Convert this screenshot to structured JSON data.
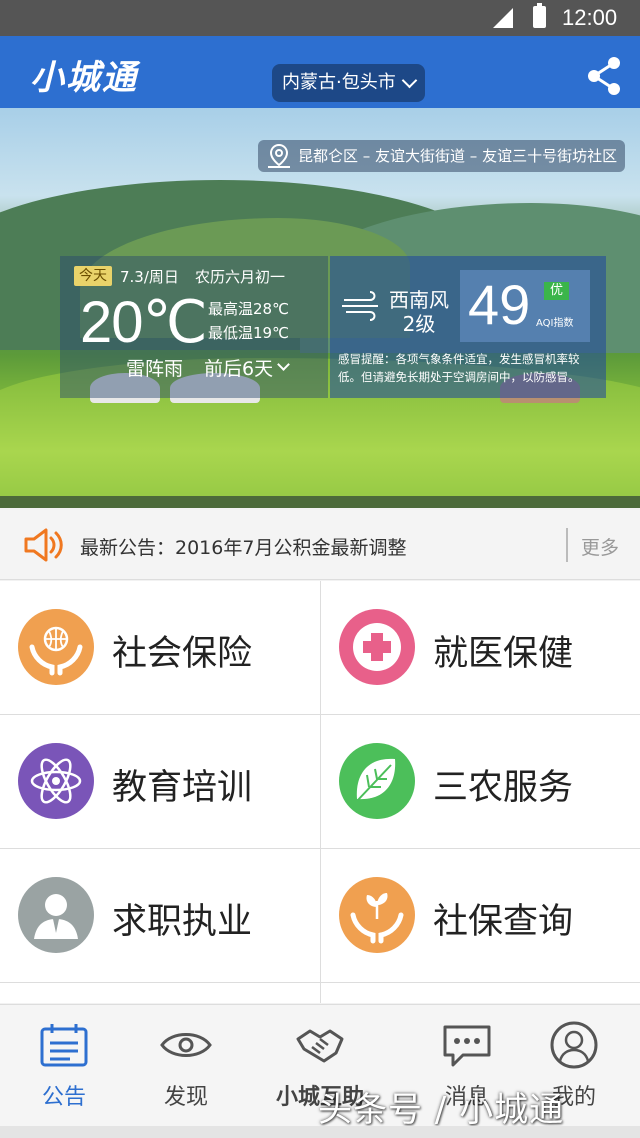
{
  "status_bar": {
    "time": "12:00"
  },
  "app_bar": {
    "title": "小城通",
    "city": "内蒙古·包头市"
  },
  "hero": {
    "address": "昆都仑区 – 友谊大街街道 – 友谊三十号街坊社区",
    "weather": {
      "today_tag": "今天",
      "date": "7.3/周日",
      "lunar": "农历六月初一",
      "temperature": "20℃",
      "high": "最高温28℃",
      "low": "最低温19℃",
      "condition": "雷阵雨",
      "forecast_link": "前后6天",
      "wind_direction": "西南风",
      "wind_level": "2级",
      "aqi_value": "49",
      "aqi_level": "优",
      "aqi_label": "AQI指数",
      "tip": "感冒提醒：各项气象条件适宜，发生感冒机率较低。但请避免长期处于空调房间中，以防感冒。"
    }
  },
  "notice": {
    "text": "最新公告：2016年7月公积金最新调整",
    "more": "更多"
  },
  "services": [
    {
      "label": "社会保险",
      "icon": "hands-globe-icon",
      "color": "#f0a050"
    },
    {
      "label": "就医保健",
      "icon": "medical-cross-icon",
      "color": "#e8608a"
    },
    {
      "label": "教育培训",
      "icon": "atom-icon",
      "color": "#7a55b8"
    },
    {
      "label": "三农服务",
      "icon": "leaf-icon",
      "color": "#4cbf5a"
    },
    {
      "label": "求职执业",
      "icon": "person-suit-icon",
      "color": "#9aa3a3"
    },
    {
      "label": "社保查询",
      "icon": "hands-plant-icon",
      "color": "#f0a050"
    }
  ],
  "bottom_nav": [
    {
      "label": "公告",
      "icon": "notice-board-icon",
      "active": true
    },
    {
      "label": "发现",
      "icon": "eye-icon",
      "active": false
    },
    {
      "label": "小城互助",
      "icon": "handshake-icon",
      "active": false
    },
    {
      "label": "消息",
      "icon": "chat-bubble-icon",
      "active": false
    },
    {
      "label": "我的",
      "icon": "user-avatar-icon",
      "active": false
    }
  ],
  "watermark": "头条号 / 小城通",
  "colors": {
    "primary": "#2d6fd0",
    "accent_orange": "#f07820"
  }
}
